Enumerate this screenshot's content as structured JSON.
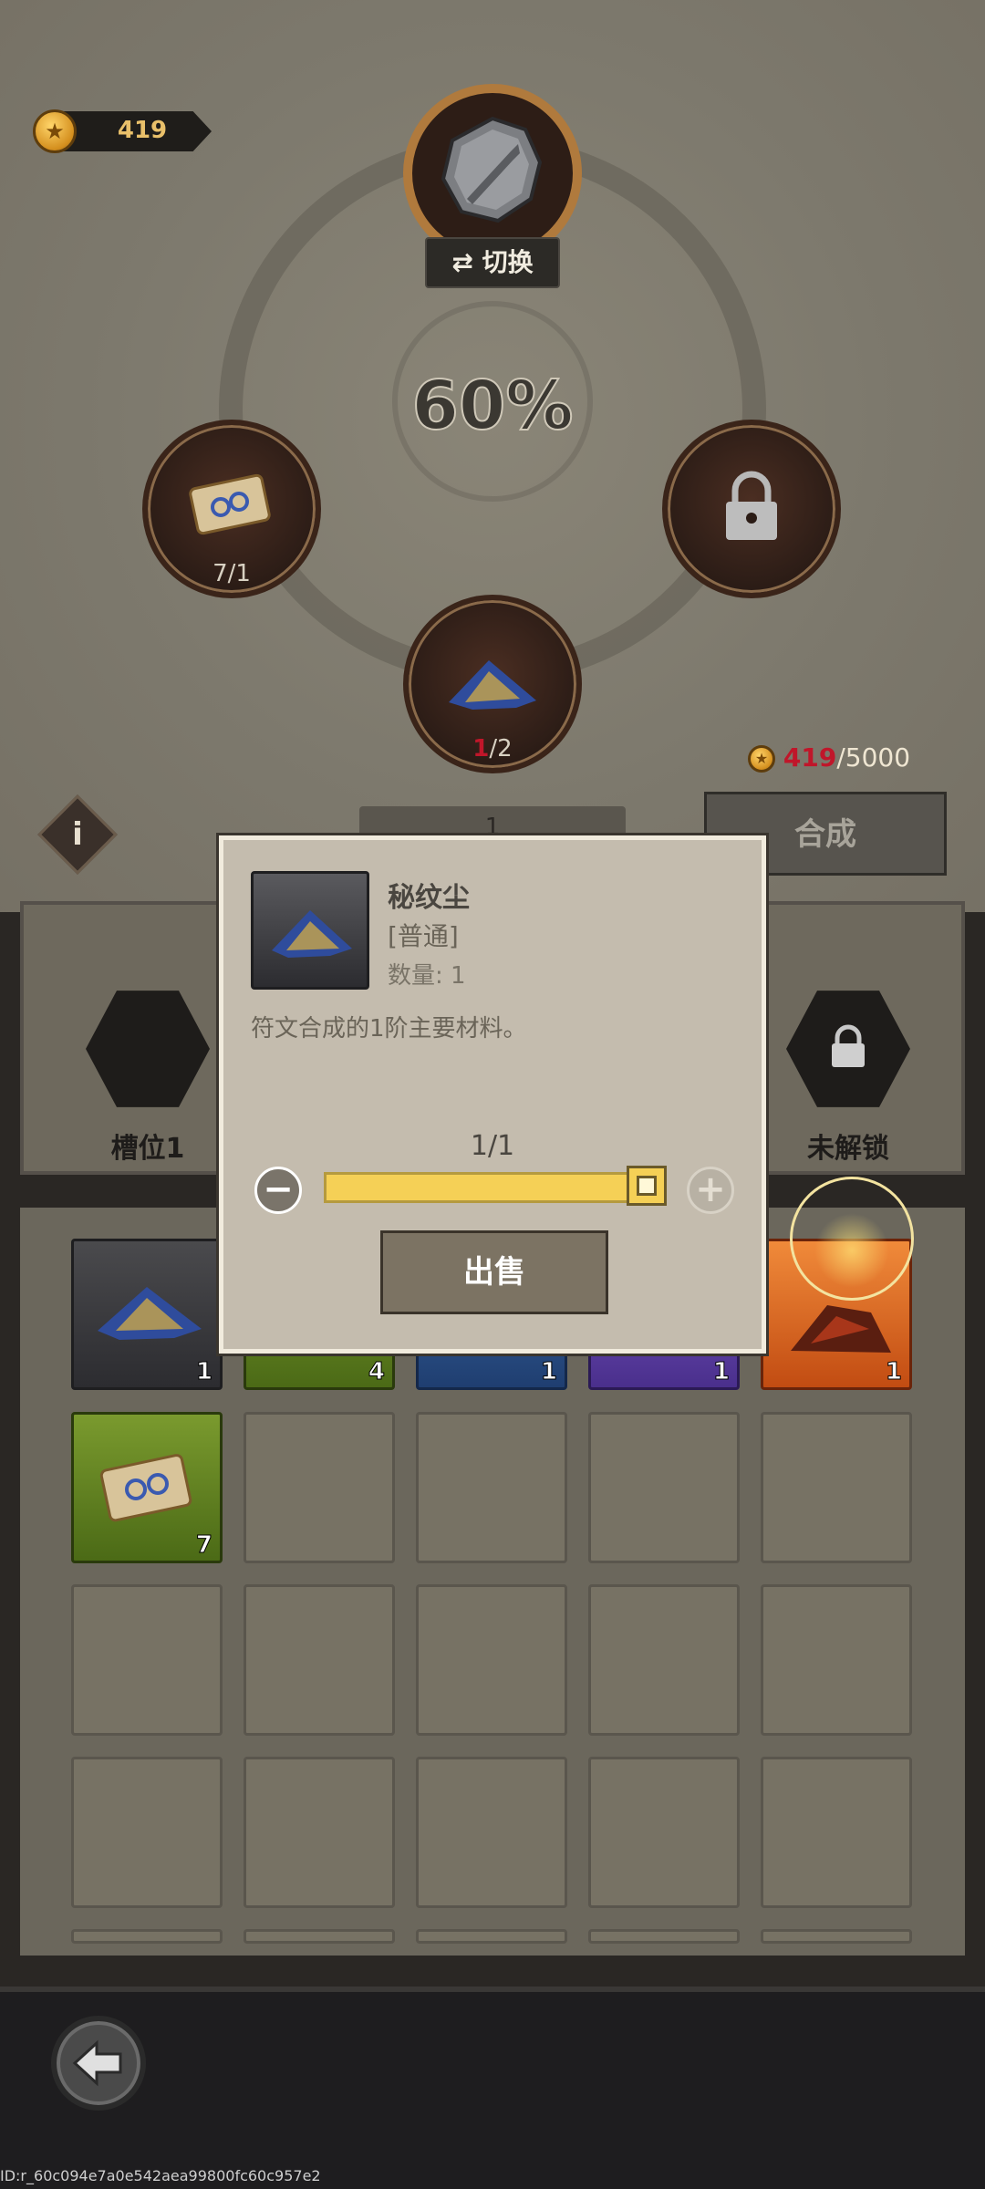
{
  "coins": {
    "amount": "419"
  },
  "top_slot": {
    "switch_label": "切换"
  },
  "success_rate": "60%",
  "left_slot": {
    "count": "7/1"
  },
  "bottom_slot": {
    "have": "1",
    "need": "/2"
  },
  "cost": {
    "have": "419",
    "need": "/5000"
  },
  "craft_button": "合成",
  "info_label": "i",
  "quantity_stepper": {
    "value": "1"
  },
  "slots": [
    {
      "label": "槽位1"
    },
    {
      "label": "未解锁"
    }
  ],
  "inventory": {
    "row1": [
      {
        "rarity": "gray",
        "count": "1"
      },
      {
        "rarity": "green",
        "count": "4"
      },
      {
        "rarity": "blue",
        "count": "1"
      },
      {
        "rarity": "purple",
        "count": "1"
      },
      {
        "rarity": "orange",
        "count": "1"
      }
    ],
    "row2": [
      {
        "rarity": "green",
        "count": "7"
      }
    ]
  },
  "dialog": {
    "item_name": "秘纹尘",
    "rarity": "[普通]",
    "quantity": "数量: 1",
    "description": "符文合成的1阶主要材料。",
    "sell_count": "1/1",
    "sell_fraction": 1.0,
    "sell_button": "出售"
  },
  "footer": {
    "id": "ID:r_60c094e7a0e542aea99800fc60c957e2"
  },
  "colors": {
    "accent_gold": "#e9c06a",
    "slider_fill": "#f5d056",
    "have_red": "#c0162a"
  }
}
